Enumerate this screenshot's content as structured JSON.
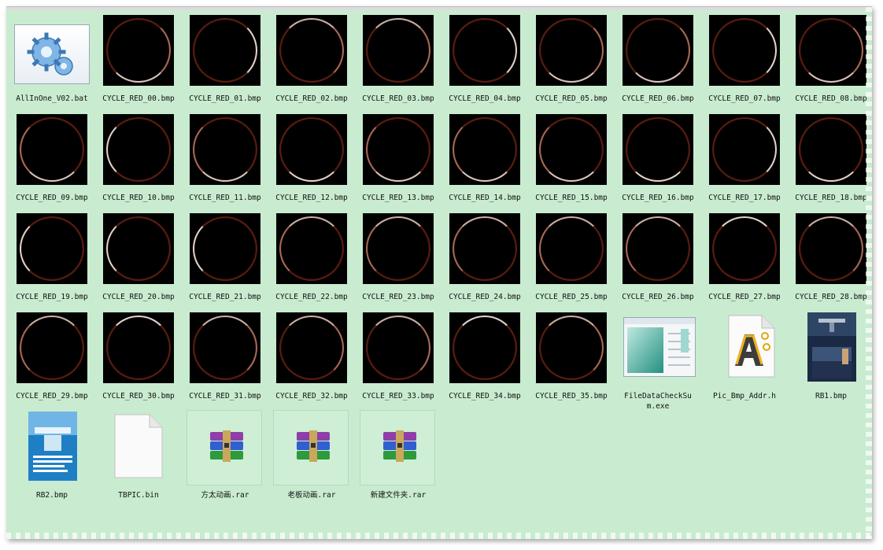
{
  "files": [
    {
      "name": "AllInOne_V02.bat",
      "kind": "bat",
      "icon": "gears-icon"
    },
    {
      "name": "CYCLE_RED_00.bmp",
      "kind": "circle",
      "hl": "se"
    },
    {
      "name": "CYCLE_RED_01.bmp",
      "kind": "circle",
      "hl": "e"
    },
    {
      "name": "CYCLE_RED_02.bmp",
      "kind": "circle",
      "hl": "ne"
    },
    {
      "name": "CYCLE_RED_03.bmp",
      "kind": "circle",
      "hl": "ne"
    },
    {
      "name": "CYCLE_RED_04.bmp",
      "kind": "circle",
      "hl": "e"
    },
    {
      "name": "CYCLE_RED_05.bmp",
      "kind": "circle",
      "hl": "se"
    },
    {
      "name": "CYCLE_RED_06.bmp",
      "kind": "circle",
      "hl": "se"
    },
    {
      "name": "CYCLE_RED_07.bmp",
      "kind": "circle",
      "hl": "e"
    },
    {
      "name": "CYCLE_RED_08.bmp",
      "kind": "circle",
      "hl": "se"
    },
    {
      "name": "CYCLE_RED_09.bmp",
      "kind": "circle",
      "hl": "sw"
    },
    {
      "name": "CYCLE_RED_10.bmp",
      "kind": "circle",
      "hl": "w"
    },
    {
      "name": "CYCLE_RED_11.bmp",
      "kind": "circle",
      "hl": "sw"
    },
    {
      "name": "CYCLE_RED_12.bmp",
      "kind": "circle",
      "hl": "s"
    },
    {
      "name": "CYCLE_RED_13.bmp",
      "kind": "circle",
      "hl": "sw"
    },
    {
      "name": "CYCLE_RED_14.bmp",
      "kind": "circle",
      "hl": "sw"
    },
    {
      "name": "CYCLE_RED_15.bmp",
      "kind": "circle",
      "hl": "sw"
    },
    {
      "name": "CYCLE_RED_16.bmp",
      "kind": "circle",
      "hl": "s"
    },
    {
      "name": "CYCLE_RED_17.bmp",
      "kind": "circle",
      "hl": "e"
    },
    {
      "name": "CYCLE_RED_18.bmp",
      "kind": "circle",
      "hl": "s"
    },
    {
      "name": "CYCLE_RED_19.bmp",
      "kind": "circle",
      "hl": "w"
    },
    {
      "name": "CYCLE_RED_20.bmp",
      "kind": "circle",
      "hl": "w"
    },
    {
      "name": "CYCLE_RED_21.bmp",
      "kind": "circle",
      "hl": "w"
    },
    {
      "name": "CYCLE_RED_22.bmp",
      "kind": "circle",
      "hl": "nw"
    },
    {
      "name": "CYCLE_RED_23.bmp",
      "kind": "circle",
      "hl": "nw"
    },
    {
      "name": "CYCLE_RED_24.bmp",
      "kind": "circle",
      "hl": "nw"
    },
    {
      "name": "CYCLE_RED_25.bmp",
      "kind": "circle",
      "hl": "nw"
    },
    {
      "name": "CYCLE_RED_26.bmp",
      "kind": "circle",
      "hl": "nw"
    },
    {
      "name": "CYCLE_RED_27.bmp",
      "kind": "circle",
      "hl": "n"
    },
    {
      "name": "CYCLE_RED_28.bmp",
      "kind": "circle",
      "hl": "ne"
    },
    {
      "name": "CYCLE_RED_29.bmp",
      "kind": "circle",
      "hl": "nw"
    },
    {
      "name": "CYCLE_RED_30.bmp",
      "kind": "circle",
      "hl": "n"
    },
    {
      "name": "CYCLE_RED_31.bmp",
      "kind": "circle",
      "hl": "ne"
    },
    {
      "name": "CYCLE_RED_32.bmp",
      "kind": "circle",
      "hl": "ne"
    },
    {
      "name": "CYCLE_RED_33.bmp",
      "kind": "circle",
      "hl": "ne"
    },
    {
      "name": "CYCLE_RED_34.bmp",
      "kind": "circle",
      "hl": "n"
    },
    {
      "name": "CYCLE_RED_35.bmp",
      "kind": "circle",
      "hl": "ne"
    },
    {
      "name": "FileDataCheckSum.exe",
      "kind": "exe",
      "icon": "window-app-icon"
    },
    {
      "name": "Pic_Bmp_Addr.h",
      "kind": "h",
      "icon": "header-file-icon"
    },
    {
      "name": "RB1.bmp",
      "kind": "rb1",
      "icon": "kitchen-image-icon"
    },
    {
      "name": "RB2.bmp",
      "kind": "rb2",
      "icon": "brochure-image-icon"
    },
    {
      "name": "TBPIC.bin",
      "kind": "bin",
      "icon": "blank-file-icon"
    },
    {
      "name": "方太动画.rar",
      "kind": "rar",
      "icon": "winrar-archive-icon"
    },
    {
      "name": "老板动画.rar",
      "kind": "rar",
      "icon": "winrar-archive-icon"
    },
    {
      "name": "新建文件夹.rar",
      "kind": "rar",
      "icon": "winrar-archive-icon"
    }
  ],
  "colors": {
    "pane_background": "#c9ecd0",
    "ring": "#5a1c10",
    "ring_highlight": "#d8c6bd"
  }
}
